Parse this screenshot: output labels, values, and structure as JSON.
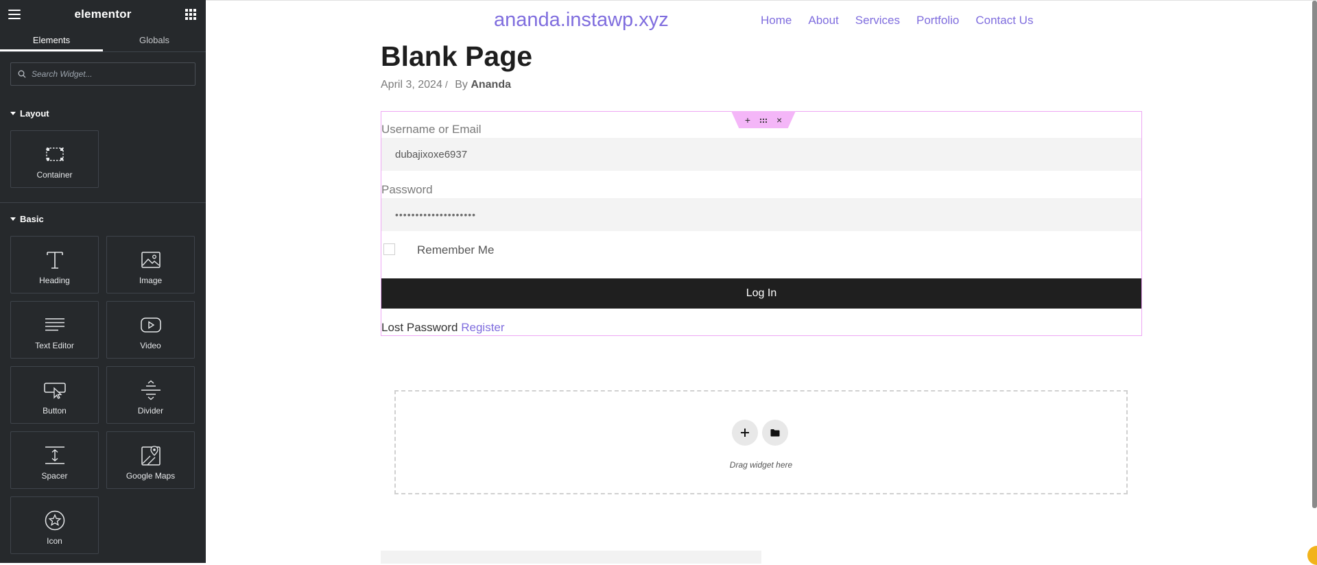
{
  "sidebar": {
    "logo": "elementor",
    "tabs": [
      {
        "label": "Elements",
        "active": true
      },
      {
        "label": "Globals",
        "active": false
      }
    ],
    "search_placeholder": "Search Widget...",
    "sections": {
      "layout": {
        "title": "Layout",
        "widgets": [
          {
            "label": "Container",
            "icon": "container-icon"
          }
        ]
      },
      "basic": {
        "title": "Basic",
        "widgets": [
          {
            "label": "Heading",
            "icon": "heading-icon"
          },
          {
            "label": "Image",
            "icon": "image-icon"
          },
          {
            "label": "Text Editor",
            "icon": "text-editor-icon"
          },
          {
            "label": "Video",
            "icon": "video-icon"
          },
          {
            "label": "Button",
            "icon": "button-icon"
          },
          {
            "label": "Divider",
            "icon": "divider-icon"
          },
          {
            "label": "Spacer",
            "icon": "spacer-icon"
          },
          {
            "label": "Google Maps",
            "icon": "google-maps-icon"
          },
          {
            "label": "Icon",
            "icon": "star-icon"
          }
        ]
      }
    }
  },
  "site": {
    "title": "ananda.instawp.xyz",
    "nav": [
      "Home",
      "About",
      "Services",
      "Portfolio",
      "Contact Us"
    ]
  },
  "page": {
    "title": "Blank Page",
    "date": "April 3, 2024",
    "separator": "/",
    "by": "By",
    "author": "Ananda"
  },
  "login_form": {
    "username_label": "Username or Email",
    "username_value": "dubajixoxe6937",
    "password_label": "Password",
    "password_value": "••••••••••••••••••••",
    "remember_label": "Remember Me",
    "login_button": "Log In",
    "lost_password": "Lost Password",
    "register": "Register"
  },
  "drop_zone": {
    "text": "Drag widget here"
  },
  "colors": {
    "sidebar_bg": "#26292c",
    "accent": "#7f6dde",
    "selection": "#eea6f4",
    "login_button_bg": "#1f1f1f"
  }
}
